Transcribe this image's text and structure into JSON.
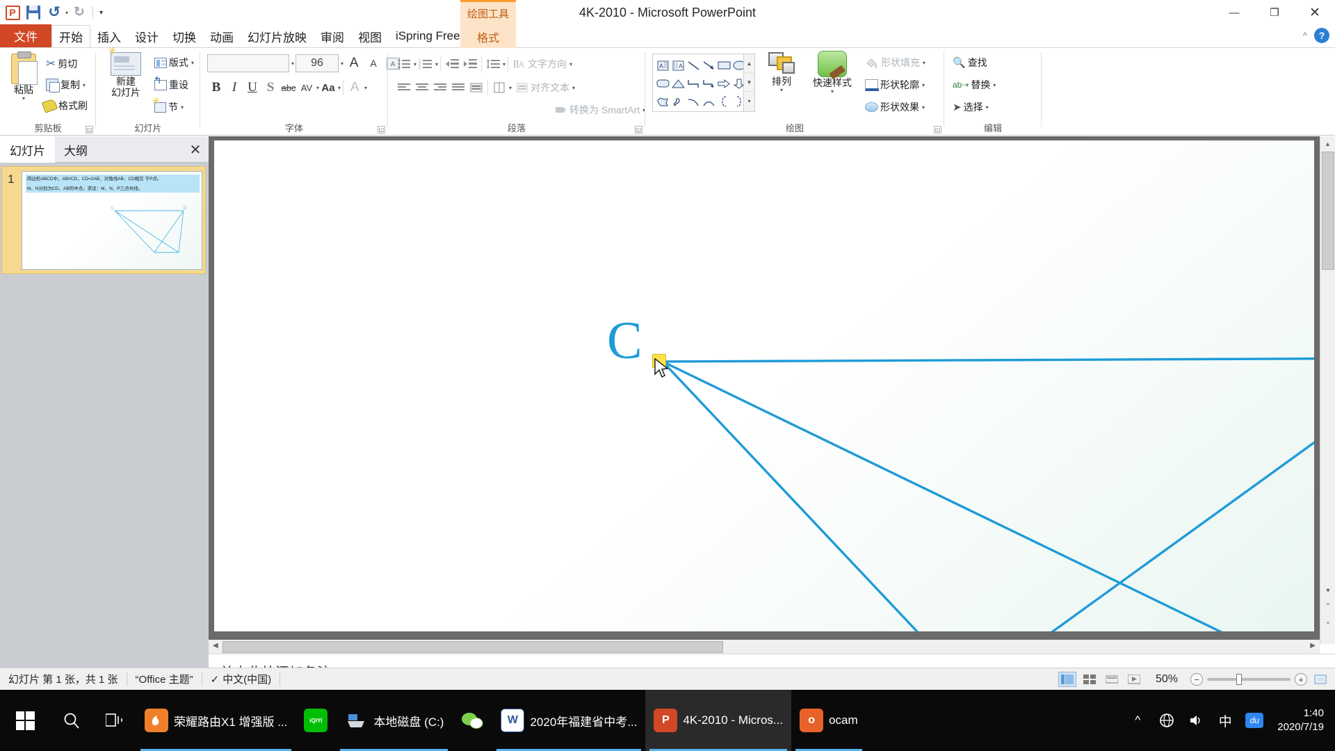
{
  "window": {
    "title": "4K-2010 - Microsoft PowerPoint",
    "minimize": "—",
    "restore": "❐",
    "close": "✕"
  },
  "qat": {
    "logo": "P",
    "save": "save-icon",
    "undo": "↺",
    "redo": "↻",
    "more": "▾"
  },
  "tabs": {
    "file": "文件",
    "items": [
      {
        "label": "开始",
        "active": true
      },
      {
        "label": "插入",
        "active": false
      },
      {
        "label": "设计",
        "active": false
      },
      {
        "label": "切换",
        "active": false
      },
      {
        "label": "动画",
        "active": false
      },
      {
        "label": "幻灯片放映",
        "active": false
      },
      {
        "label": "审阅",
        "active": false
      },
      {
        "label": "视图",
        "active": false
      },
      {
        "label": "iSpring Free",
        "active": false
      }
    ],
    "context_header": "绘图工具",
    "context_tab": "格式",
    "collapse_ribbon": "^",
    "help": "?"
  },
  "ribbon": {
    "groups": [
      {
        "name": "clipboard",
        "label": "剪贴板"
      },
      {
        "name": "slides",
        "label": "幻灯片"
      },
      {
        "name": "font",
        "label": "字体"
      },
      {
        "name": "paragraph",
        "label": "段落"
      },
      {
        "name": "drawing",
        "label": "绘图"
      },
      {
        "name": "editing",
        "label": "编辑"
      }
    ],
    "clipboard": {
      "paste": "粘贴",
      "cut": "剪切",
      "copy": "复制",
      "format_painter": "格式刷"
    },
    "slides": {
      "new_slide_line1": "新建",
      "new_slide_line2": "幻灯片",
      "layout": "版式",
      "reset": "重设",
      "section": "节"
    },
    "font": {
      "font_family_value": "",
      "font_size_value": "96",
      "bold": "B",
      "italic": "I",
      "underline": "U",
      "shadow": "S",
      "strikethrough": "abc",
      "char_spacing": "AV",
      "change_case": "Aa",
      "font_color": "A",
      "grow_font": "A",
      "shrink_font": "A",
      "clear_format": "clear-formatting-icon"
    },
    "paragraph": {
      "text_direction": "文字方向",
      "align_text": "对齐文本",
      "convert_smartart": "转换为 SmartArt"
    },
    "drawing": {
      "arrange": "排列",
      "quick_styles": "快速样式",
      "shape_fill": "形状填充",
      "shape_outline": "形状轮廓",
      "shape_effects": "形状效果"
    },
    "editing": {
      "find": "查找",
      "replace": "替换",
      "select": "选择"
    }
  },
  "left_pane": {
    "tab_slides": "幻灯片",
    "tab_outline": "大纲",
    "close": "✕",
    "slide_number": "1",
    "thumb_text_line1": "四边形ABCD中，AB//CD，CD=2AB、对角线AB、CD相交 于P点。",
    "thumb_text_line2": "M、N分别为CD、AB的中点。求证：M、N、P三点共线。"
  },
  "slide": {
    "label_c": "C",
    "label_d": "D",
    "shape_color": "#1f9bd8",
    "handle_color": "#ffe14d"
  },
  "notes": {
    "placeholder": "单击此处添加备注"
  },
  "status_bar": {
    "slide_count": "幻灯片 第 1 张，共 1 张",
    "theme": "“Office 主题”",
    "language": "中文(中国)",
    "zoom_value": "50%",
    "zoom_out": "−",
    "zoom_in": "+",
    "fit_window": "fit-slide-to-window-icon",
    "views": [
      "normal-view-icon",
      "slide-sorter-icon",
      "reading-view-icon",
      "slideshow-icon"
    ]
  },
  "taskbar": {
    "start": "start-button",
    "search": "search-icon",
    "task_view": "task-view-icon",
    "apps": [
      {
        "label": "荣耀路由X1 增强版 ...",
        "icon_text": "",
        "icon_color": "#ef7f2a",
        "running": true,
        "active": false
      },
      {
        "label": "",
        "icon_text": "iQIYI",
        "icon_color": "#00be06",
        "running": false,
        "active": false
      },
      {
        "label": "本地磁盘 (C:)",
        "icon_text": "",
        "icon_color": "#4a5a68",
        "running": true,
        "active": false
      },
      {
        "label": "",
        "icon_text": "",
        "icon_color": "#7bd14a",
        "running": false,
        "active": false
      },
      {
        "label": "2020年福建省中考...",
        "icon_text": "W",
        "icon_color": "#2b579a",
        "running": true,
        "active": false
      },
      {
        "label": "4K-2010 - Micros...",
        "icon_text": "P",
        "icon_color": "#d24726",
        "running": true,
        "active": true
      },
      {
        "label": "ocam",
        "icon_text": "o",
        "icon_color": "#e8622a",
        "running": true,
        "active": false
      }
    ],
    "tray": {
      "chevron": "^",
      "network": "network-icon",
      "volume": "volume-icon",
      "ime": "中",
      "ime2": "du",
      "time": "1:40",
      "date": "2020/7/19"
    }
  }
}
